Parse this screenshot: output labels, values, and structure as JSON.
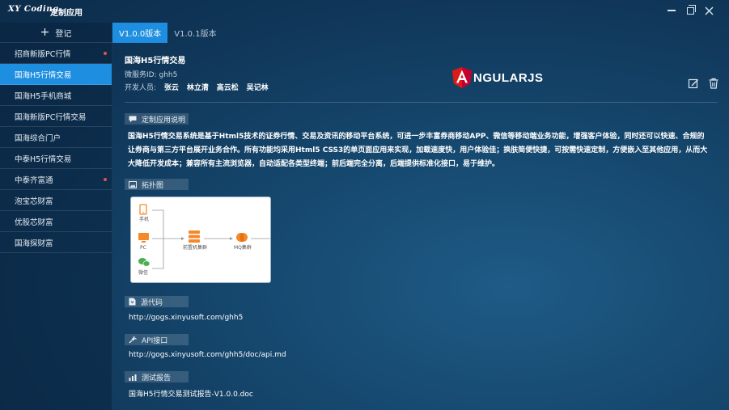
{
  "window": {
    "logo_text": "XY Coding",
    "app_title": "定制应用"
  },
  "sidebar": {
    "login_label": "登记",
    "items": [
      {
        "label": "招商新版PC行情",
        "dot": true
      },
      {
        "label": "国海H5行情交易",
        "dot": false
      },
      {
        "label": "国海H5手机商城",
        "dot": false
      },
      {
        "label": "国海新版PC行情交易",
        "dot": false
      },
      {
        "label": "国海综合门户",
        "dot": false
      },
      {
        "label": "中泰H5行情交易",
        "dot": false
      },
      {
        "label": "中泰齐富通",
        "dot": true
      },
      {
        "label": "泡宝芯财富",
        "dot": false
      },
      {
        "label": "优股芯财富",
        "dot": false
      },
      {
        "label": "国海探财富",
        "dot": false
      }
    ],
    "active_index": 1
  },
  "tabs": [
    {
      "label": "V1.0.0版本",
      "active": true
    },
    {
      "label": "V1.0.1版本",
      "active": false
    }
  ],
  "service": {
    "name": "国海H5行情交易",
    "id_text": "微服务ID: ghh5",
    "dev_label": "开发人员:",
    "developers": [
      "张云",
      "林立清",
      "高云松",
      "吴记林"
    ],
    "framework_logo": "NGULARJS"
  },
  "sections": {
    "description": {
      "title": "定制应用说明",
      "text": "国海H5行情交易系统是基于Html5技术的证券行情、交易及资讯的移动平台系统，可进一步丰富券商移动APP、微信等移动端业务功能，增强客户体验，同时还可以快速、合规的让券商与第三方平台展开业务合作。所有功能均采用Html5 CSS3的单页面应用来实现，加载速度快，用户体验佳；换肤简便快捷，可按需快速定制，方便嵌入至其他应用，从而大大降低开发成本；兼容所有主流浏览器，自动适配各类型终端；前后端完全分离，后端提供标准化接口，易于维护。"
    },
    "topology": {
      "title": "拓扑图",
      "nodes": {
        "phone": "手机",
        "pc": "PC",
        "wechat": "微信",
        "front": "前置机集群",
        "mq": "MQ集群"
      }
    },
    "source": {
      "title": "源代码",
      "url": "http://gogs.xinyusoft.com/ghh5"
    },
    "api": {
      "title": "API接口",
      "url": "http://gogs.xinyusoft.com/ghh5/doc/api.md"
    },
    "test": {
      "title": "测试报告",
      "file": "国海H5行情交易测试报告-V1.0.0.doc"
    }
  },
  "colors": {
    "accent": "#1e8ee0",
    "dot": "#e8524c",
    "angular_red": "#dd1b16",
    "topo_orange": "#f5892a",
    "topo_green": "#4caf50"
  }
}
